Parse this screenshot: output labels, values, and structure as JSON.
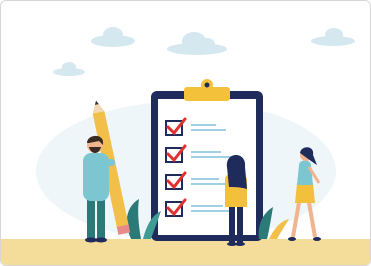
{
  "illustration": {
    "subject": "checklist-clipboard",
    "checklist_items": [
      {
        "checked": true
      },
      {
        "checked": true
      },
      {
        "checked": true
      },
      {
        "checked": true
      }
    ],
    "people": [
      "man-with-pencil",
      "woman-in-front-of-clipboard",
      "woman-walking"
    ],
    "colors": {
      "clipboard": "#1f2b5b",
      "clip": "#f4c23a",
      "paper": "#ffffff",
      "checkmark": "#e0312f",
      "line": "#9fd0e6",
      "ground": "#f4dd9a",
      "cloud": "#cfe4ee",
      "plant": "#2c7a77",
      "pencil": "#f2c04a",
      "skin": "#f2b48f",
      "shirt_man": "#7cc6d1",
      "shirt_woman": "#f3c03c"
    }
  }
}
